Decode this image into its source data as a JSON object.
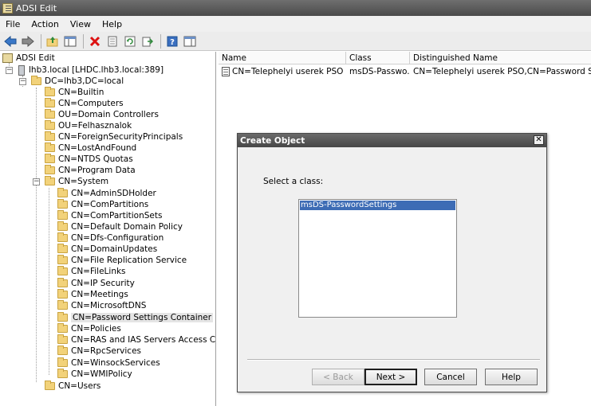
{
  "window": {
    "title": "ADSI Edit"
  },
  "menu": {
    "items": [
      "File",
      "Action",
      "View",
      "Help"
    ]
  },
  "toolbar": {
    "icons": [
      "back-arrow-icon",
      "forward-arrow-icon",
      "up-folder-icon",
      "show-hide-tree-icon",
      "delete-icon",
      "properties-icon",
      "refresh-icon",
      "export-list-icon",
      "help-icon",
      "show-hide-action-pane-icon"
    ]
  },
  "tree": {
    "root": "ADSI Edit",
    "server": "lhb3.local [LHDC.lhb3.local:389]",
    "domain": "DC=lhb3,DC=local",
    "level1": [
      "CN=Builtin",
      "CN=Computers",
      "OU=Domain Controllers",
      "OU=Felhasznalok",
      "CN=ForeignSecurityPrincipals",
      "CN=LostAndFound",
      "CN=NTDS Quotas",
      "CN=Program Data",
      "CN=System"
    ],
    "system_children": [
      "CN=AdminSDHolder",
      "CN=ComPartitions",
      "CN=ComPartitionSets",
      "CN=Default Domain Policy",
      "CN=Dfs-Configuration",
      "CN=DomainUpdates",
      "CN=File Replication Service",
      "CN=FileLinks",
      "CN=IP Security",
      "CN=Meetings",
      "CN=MicrosoftDNS",
      "CN=Password Settings Container",
      "CN=Policies",
      "CN=RAS and IAS Servers Access Check",
      "CN=RpcServices",
      "CN=WinsockServices",
      "CN=WMIPolicy"
    ],
    "last": "CN=Users",
    "selected": "CN=Password Settings Container"
  },
  "list": {
    "columns": [
      "Name",
      "Class",
      "Distinguished Name"
    ],
    "rows": [
      {
        "name": "CN=Telephelyi userek PSO",
        "class": "msDS-Passwo...",
        "dn": "CN=Telephelyi userek PSO,CN=Password Settings"
      }
    ]
  },
  "dialog": {
    "title": "Create Object",
    "close_glyph": "✕",
    "prompt": "Select a class:",
    "options": [
      "msDS-PasswordSettings"
    ],
    "buttons": {
      "back": "< Back",
      "next": "Next >",
      "cancel": "Cancel",
      "help": "Help"
    }
  }
}
